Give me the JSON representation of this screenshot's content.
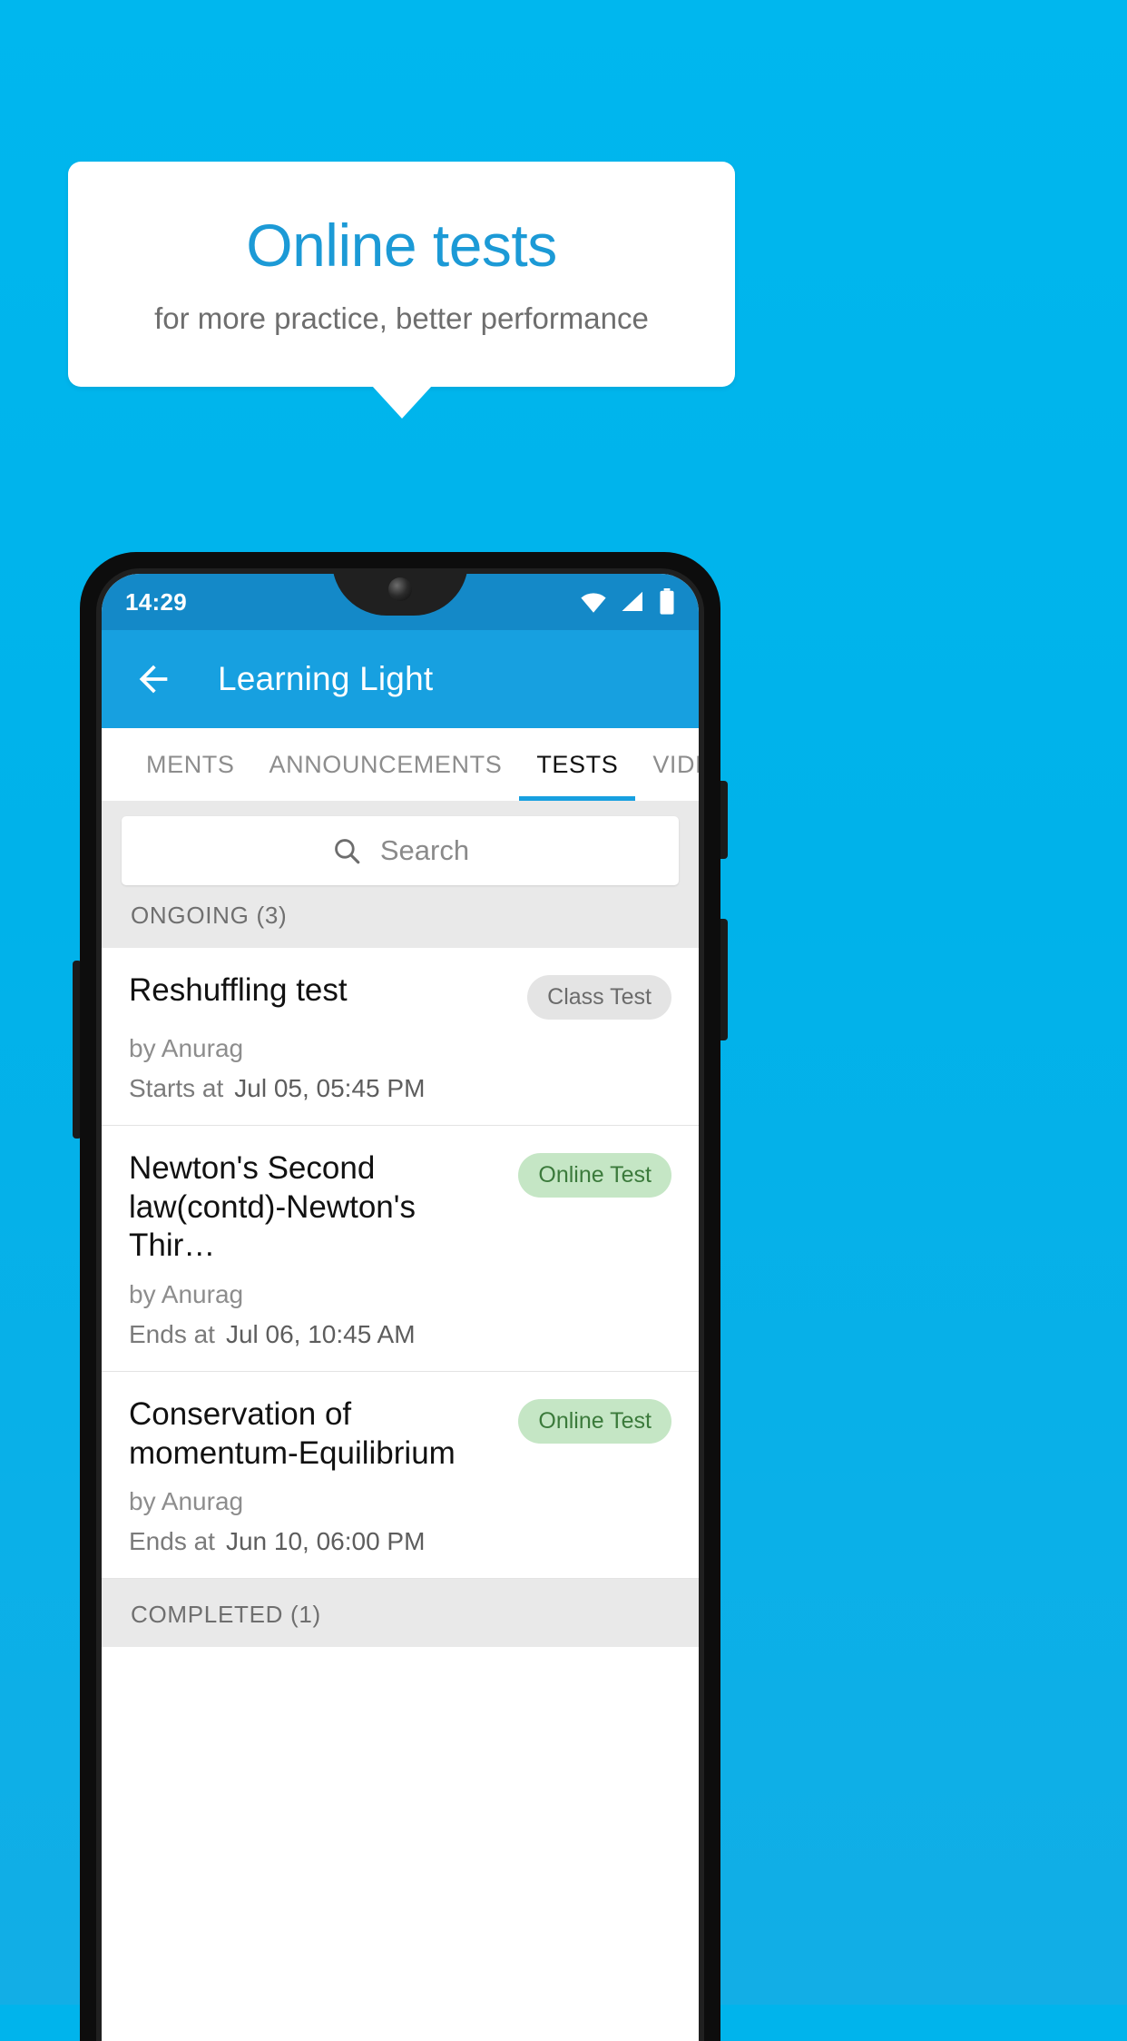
{
  "promo": {
    "title": "Online tests",
    "subtitle": "for more practice, better performance",
    "title_color": "#1c9ad6",
    "background_color": "#00b4ec"
  },
  "phone": {
    "statusbar": {
      "time": "14:29",
      "icons": [
        "wifi-icon",
        "signal-icon",
        "battery-icon"
      ],
      "background_color": "#1489c8"
    },
    "appbar": {
      "back_label": "back-arrow-icon",
      "title": "Learning Light",
      "background_color": "#17a0e0"
    },
    "tabs": [
      {
        "label": "MENTS",
        "active": false
      },
      {
        "label": "ANNOUNCEMENTS",
        "active": false
      },
      {
        "label": "TESTS",
        "active": true
      },
      {
        "label": "VIDEOS",
        "active": false
      }
    ],
    "search": {
      "placeholder": "Search",
      "icon": "search-icon"
    },
    "sections": [
      {
        "label": "ONGOING (3)"
      },
      {
        "label": "COMPLETED (1)"
      }
    ],
    "tests": [
      {
        "title": "Reshuffling test",
        "badge": "Class Test",
        "badge_type": "class",
        "author": "by Anurag",
        "when_label": "Starts at",
        "when_value": "Jul 05, 05:45 PM"
      },
      {
        "title": "Newton's Second law(contd)-Newton's Thir…",
        "badge": "Online Test",
        "badge_type": "online",
        "author": "by Anurag",
        "when_label": "Ends at",
        "when_value": "Jul 06, 10:45 AM"
      },
      {
        "title": "Conservation of momentum-Equilibrium",
        "badge": "Online Test",
        "badge_type": "online",
        "author": "by Anurag",
        "when_label": "Ends at",
        "when_value": "Jun 10, 06:00 PM"
      }
    ]
  }
}
